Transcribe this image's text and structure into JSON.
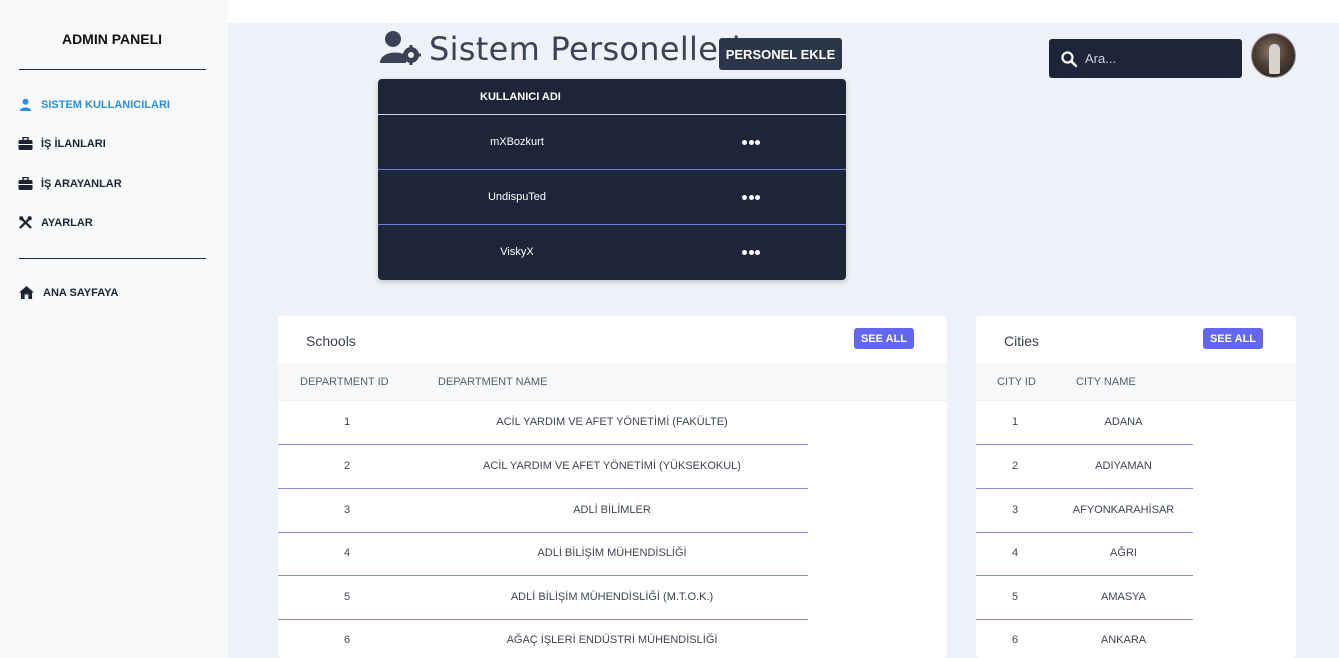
{
  "sidebar": {
    "brand": "ADMIN PANELI",
    "items": [
      {
        "label": "SISTEM KULLANICILARI",
        "icon": "user-icon",
        "active": true
      },
      {
        "label": "İŞ İLANLARI",
        "icon": "briefcase-icon"
      },
      {
        "label": "İŞ ARAYANLAR",
        "icon": "briefcase-icon"
      },
      {
        "label": "AYARLAR",
        "icon": "tools-icon"
      }
    ],
    "home": {
      "label": "ANA SAYFAYA",
      "icon": "home-icon"
    }
  },
  "header": {
    "title": "Sistem Personelleri",
    "add_button": "PERSONEL EKLE",
    "search_placeholder": "Ara..."
  },
  "users_table": {
    "column": "KULLANICI ADI",
    "rows": [
      "mXBozkurt",
      "UndispuTed",
      "ViskyX"
    ]
  },
  "schools": {
    "title": "Schools",
    "see_all": "SEE ALL",
    "columns": [
      "DEPARTMENT ID",
      "DEPARTMENT NAME"
    ],
    "rows": [
      {
        "id": "1",
        "name": "ACİL YARDIM VE AFET YÖNETİMİ (FAKÜLTE)"
      },
      {
        "id": "2",
        "name": "ACİL YARDIM VE AFET YÖNETİMİ (YÜKSEKOKUL)"
      },
      {
        "id": "3",
        "name": "ADLİ BİLİMLER"
      },
      {
        "id": "4",
        "name": "ADLİ BİLİŞİM MÜHENDİSLİĞİ"
      },
      {
        "id": "5",
        "name": "ADLİ BİLİŞİM MÜHENDİSLİĞİ (M.T.O.K.)"
      },
      {
        "id": "6",
        "name": "AĞAÇ İŞLERİ ENDÜSTRİ MÜHENDİSLİĞİ"
      }
    ]
  },
  "cities": {
    "title": "Cities",
    "see_all": "SEE ALL",
    "columns": [
      "CITY ID",
      "CITY NAME"
    ],
    "rows": [
      {
        "id": "1",
        "name": "ADANA"
      },
      {
        "id": "2",
        "name": "ADIYAMAN"
      },
      {
        "id": "3",
        "name": "AFYONKARAHİSAR"
      },
      {
        "id": "4",
        "name": "AĞRI"
      },
      {
        "id": "5",
        "name": "AMASYA"
      },
      {
        "id": "6",
        "name": "ANKARA"
      }
    ]
  },
  "colors": {
    "accent": "#6366f1",
    "active_nav": "#2a8ee0",
    "dark_panel": "#1d2639"
  }
}
